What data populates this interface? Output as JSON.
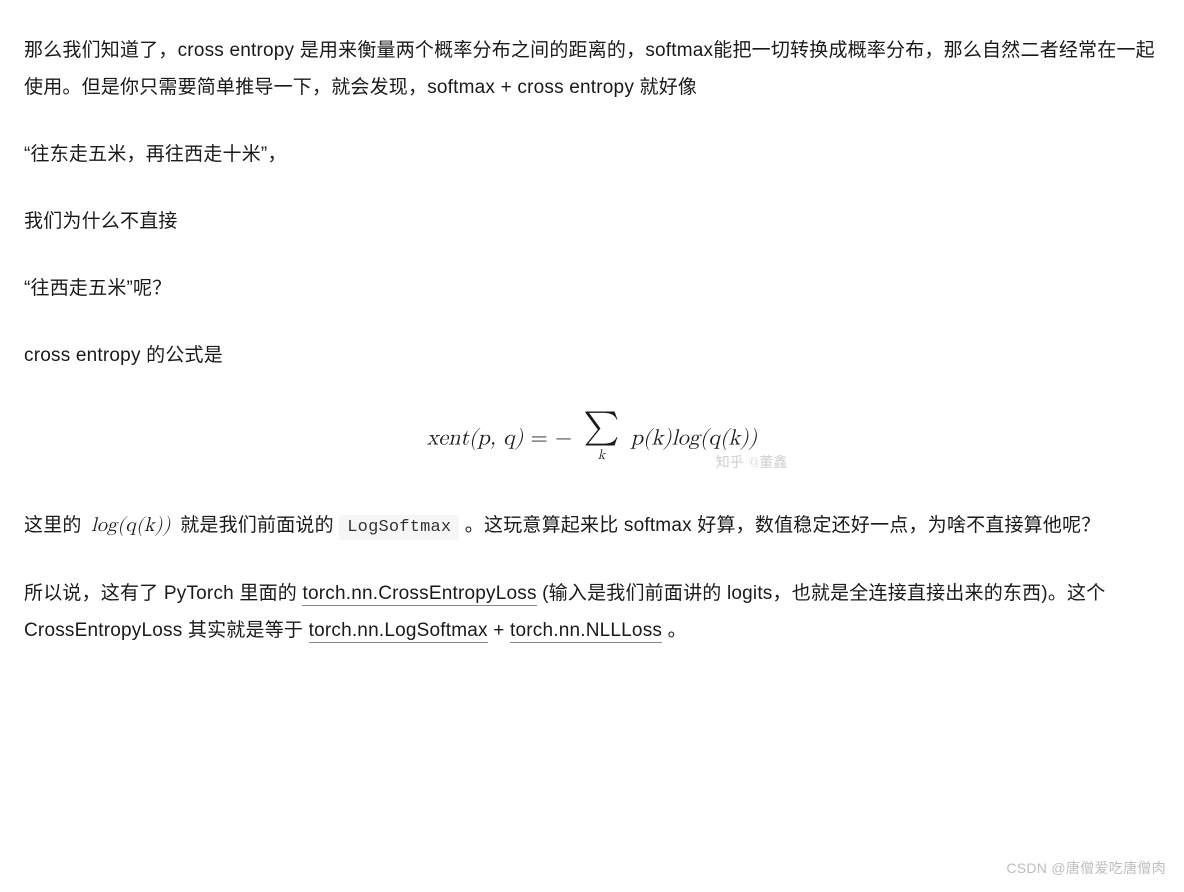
{
  "paragraphs": {
    "p1": "那么我们知道了，cross entropy 是用来衡量两个概率分布之间的距离的，softmax能把一切转换成概率分布，那么自然二者经常在一起使用。但是你只需要简单推导一下，就会发现，softmax + cross entropy 就好像",
    "p2": "“往东走五米，再往西走十米”，",
    "p3": "我们为什么不直接",
    "p4": "“往西走五米”呢？",
    "p5": "cross entropy 的公式是",
    "p6_prefix": "这里的 ",
    "p6_math": "log(q(k))",
    "p6_mid": " 就是我们前面说的 ",
    "p6_code": "LogSoftmax",
    "p6_suffix": " 。这玩意算起来比 softmax 好算，数值稳定还好一点，为啥不直接算他呢？",
    "p7_prefix": "所以说，这有了 PyTorch 里面的 ",
    "p7_link1": "torch.nn.CrossEntropyLoss",
    "p7_mid1": " (输入是我们前面讲的 logits，也就是全连接直接出来的东西)。这个 CrossEntropyLoss 其实就是等于 ",
    "p7_link2": "torch.nn.LogSoftmax",
    "p7_plus": " + ",
    "p7_link3": "torch.nn.NLLLoss",
    "p7_end": "。"
  },
  "formula": {
    "lhs": "xent(p, q)",
    "eq": " = − ",
    "sum_sym": "∑",
    "sum_sub": "k",
    "rhs": "p(k)log(q(k))",
    "watermark": "知乎 @董鑫"
  },
  "footer_watermark": "CSDN @唐僧爱吃唐僧肉"
}
